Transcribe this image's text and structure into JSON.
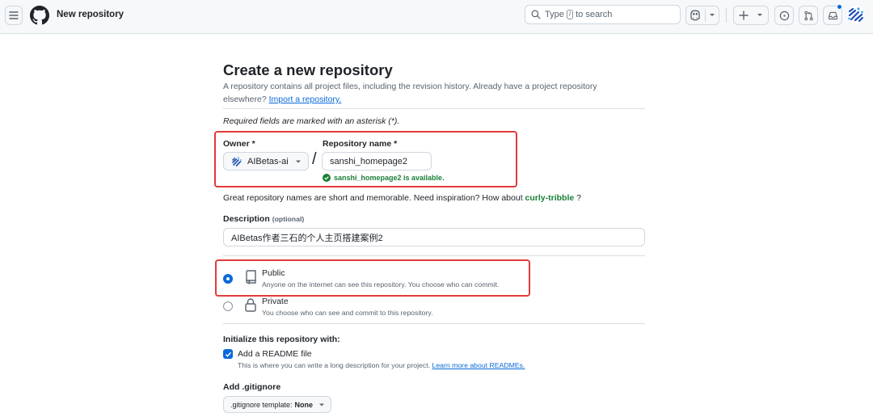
{
  "header": {
    "title": "New repository",
    "search_prefix": "Type",
    "search_key": "/",
    "search_suffix": "to search"
  },
  "form": {
    "heading": "Create a new repository",
    "subtitle": "A repository contains all project files, including the revision history. Already have a project repository elsewhere?",
    "import_link": "Import a repository.",
    "required_note": "Required fields are marked with an asterisk (*).",
    "owner_label": "Owner *",
    "owner_value": "AIBetas-ai",
    "slash": "/",
    "repo_label": "Repository name *",
    "repo_value": "sanshi_homepage2",
    "availability": "sanshi_homepage2 is available.",
    "hint_text": "Great repository names are short and memorable. Need inspiration? How about",
    "hint_suggestion": "curly-tribble",
    "hint_end": "?",
    "description_label": "Description",
    "description_optional": "(optional)",
    "description_value": "AIBetas作者三石的个人主页搭建案例2",
    "visibility": {
      "public_title": "Public",
      "public_desc": "Anyone on the internet can see this repository. You choose who can commit.",
      "private_title": "Private",
      "private_desc": "You choose who can see and commit to this repository."
    },
    "init_heading": "Initialize this repository with:",
    "readme_label": "Add a README file",
    "readme_hint": "This is where you can write a long description for your project.",
    "readme_link": "Learn more about READMEs.",
    "gitignore_heading": "Add .gitignore",
    "gitignore_prefix": ".gitignore template:",
    "gitignore_value": "None"
  },
  "colors": {
    "accent": "#0969da",
    "success": "#1a7f37",
    "callout": "#e23b3b"
  }
}
